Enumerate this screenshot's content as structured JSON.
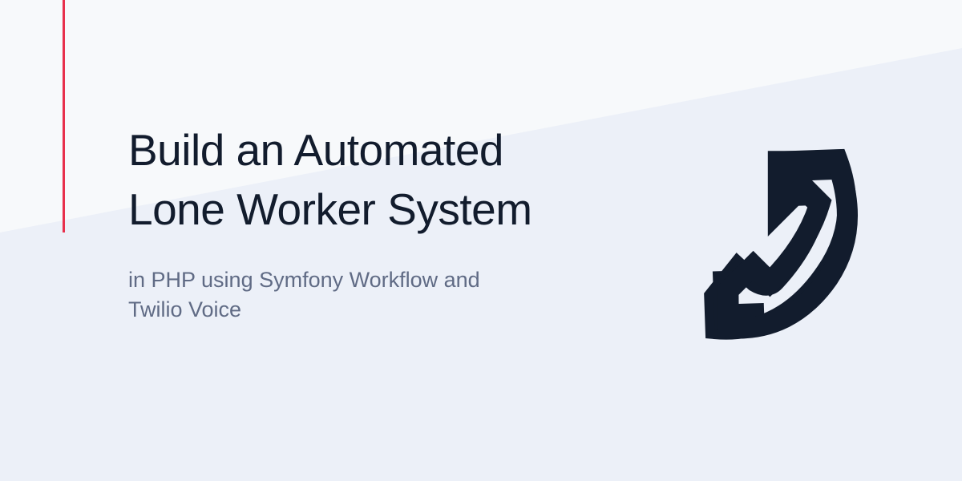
{
  "title_line1": "Build an Automated",
  "title_line2": "Lone Worker System",
  "subtitle": "in PHP using Symfony Workflow and Twilio Voice",
  "colors": {
    "accent": "#E8304C",
    "dark": "#121C2D",
    "muted": "#606B85",
    "bg_base": "#f7f9fb",
    "bg_panel": "#ecf0f8"
  },
  "icon": "phone-icon"
}
